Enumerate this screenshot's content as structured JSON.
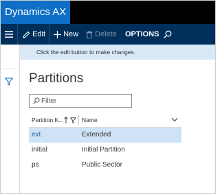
{
  "app": {
    "title": "Dynamics AX"
  },
  "actions": {
    "edit": "Edit",
    "new": "New",
    "delete": "Delete",
    "options": "OPTIONS"
  },
  "icons": {
    "menu": "hamburger-icon",
    "edit": "pencil-icon",
    "new": "plus-icon",
    "delete": "trash-icon",
    "search": "search-icon",
    "filter_pane": "funnel-icon",
    "sort": "sort-arrow-icon",
    "column_filter": "funnel-icon",
    "expand": "chevron-down-icon"
  },
  "colors": {
    "brand": "#0f6fc6",
    "action_pane": "#012f5c",
    "message_bar": "#d9e8f7",
    "selected_row": "#cfe3f6"
  },
  "message": "Click the edit button to make changes.",
  "page": {
    "title": "Partitions"
  },
  "filter": {
    "placeholder": "Filter"
  },
  "grid": {
    "columns": [
      "Partition K...",
      "Name"
    ],
    "rows": [
      {
        "key": "ext",
        "name": "Extended",
        "selected": true
      },
      {
        "key": "initial",
        "name": "Initial Partition",
        "selected": false
      },
      {
        "key": "ps",
        "name": "Public Sector",
        "selected": false
      }
    ]
  }
}
